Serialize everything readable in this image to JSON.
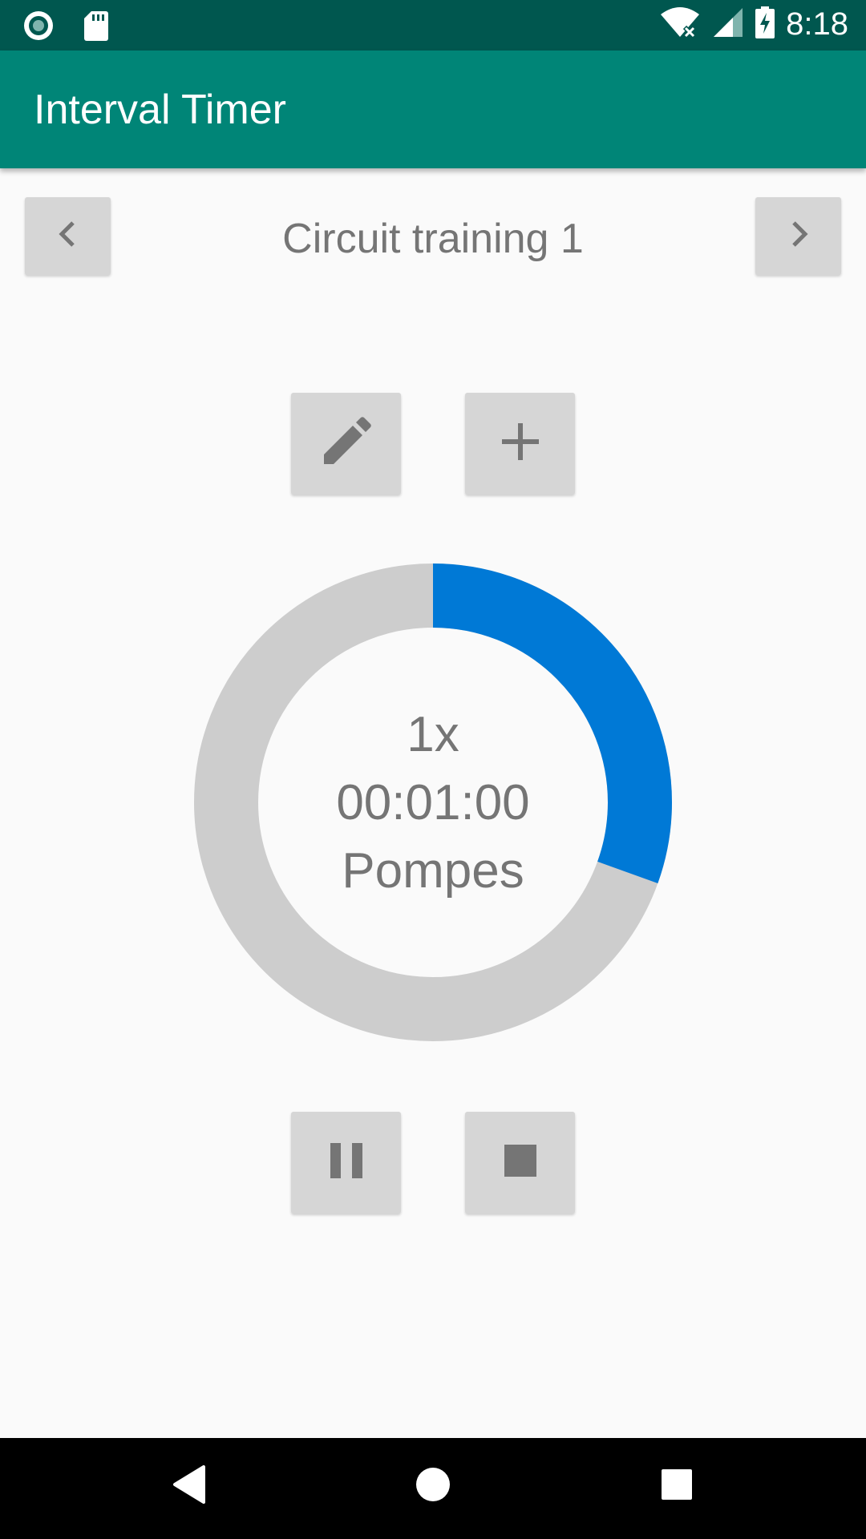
{
  "status_bar": {
    "time": "8:18",
    "icons": [
      "record-icon",
      "sd-card-icon",
      "wifi-off-icon",
      "signal-icon",
      "battery-charging-icon"
    ],
    "color": "#00574f"
  },
  "app_bar": {
    "title": "Interval Timer",
    "color": "#008577"
  },
  "workout": {
    "name": "Circuit training 1",
    "prev_icon": "chevron-left-icon",
    "next_icon": "chevron-right-icon"
  },
  "actions": {
    "edit_icon": "pencil-icon",
    "add_icon": "plus-icon"
  },
  "timer": {
    "repetitions": "1x",
    "time": "00:01:00",
    "exercise": "Pompes",
    "progress": 0.305,
    "progress_color": "#0079d6",
    "track_color": "#cdcdcd"
  },
  "controls": {
    "pause_icon": "pause-icon",
    "stop_icon": "stop-icon"
  },
  "system_nav": {
    "icons": [
      "back-icon",
      "home-icon",
      "recents-icon"
    ]
  }
}
